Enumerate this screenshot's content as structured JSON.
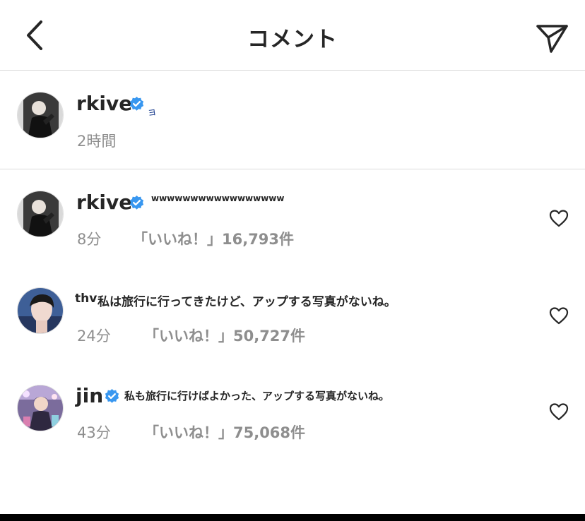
{
  "header": {
    "title": "コメント",
    "back_icon": "chevron-left-icon",
    "send_icon": "paper-plane-icon"
  },
  "caption": {
    "username": "rkive",
    "text": "ョ",
    "time": "2時間"
  },
  "comments": [
    {
      "username": "rkive",
      "text": "wwwwwwwwwwwwwwwww",
      "time": "8分",
      "likes": "「いいね！」16,793件"
    },
    {
      "username": "thv",
      "text": "私は旅行に行ってきたけど、アップする写真がないね。",
      "time": "24分",
      "likes": "「いいね！」50,727件"
    },
    {
      "username": "jin",
      "text": "私も旅行に行けばよかった、アップする写真がないね。",
      "time": "43分",
      "likes": "「いいね！」75,068件"
    }
  ],
  "colors": {
    "verified": "#3897f0",
    "muted": "#8e8e8e",
    "text": "#262626",
    "divider": "#dbdbdb"
  }
}
